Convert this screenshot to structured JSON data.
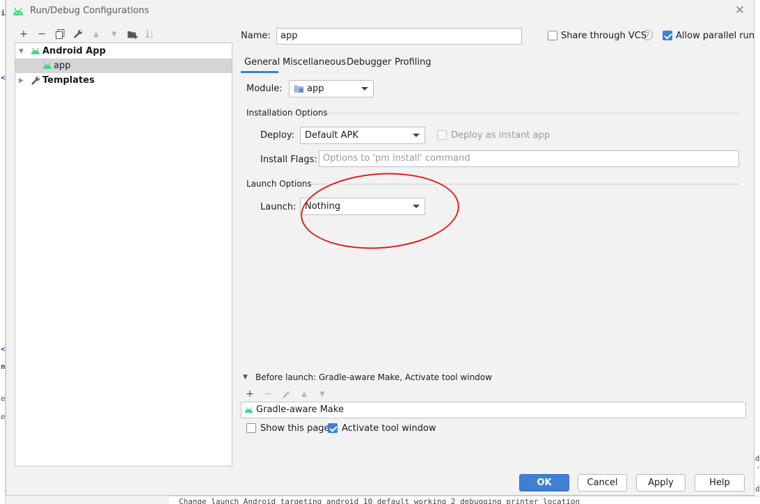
{
  "window": {
    "title": "Run/Debug Configurations"
  },
  "toolbar": {
    "add": "+",
    "remove": "−",
    "move_up": "▲",
    "move_down": "▼"
  },
  "tree": {
    "android_app": "Android App",
    "app": "app",
    "templates": "Templates"
  },
  "header": {
    "name_label": "Name:",
    "name_value": "app",
    "share_vcs": "Share through VCS",
    "help": "?",
    "allow_parallel": "Allow parallel run"
  },
  "tabs": [
    {
      "label": "General"
    },
    {
      "label": "Miscellaneous"
    },
    {
      "label": "Debugger"
    },
    {
      "label": "Profiling"
    }
  ],
  "general": {
    "module_label": "Module:",
    "module_value": "app",
    "installation_title": "Installation Options",
    "deploy_label": "Deploy:",
    "deploy_value": "Default APK",
    "instant_app": "Deploy as instant app",
    "install_flags_label": "Install Flags:",
    "install_flags_placeholder": "Options to 'pm install' command",
    "launch_title": "Launch Options",
    "launch_label": "Launch:",
    "launch_value": "Nothing"
  },
  "before_launch": {
    "title": "Before launch: Gradle-aware Make, Activate tool window",
    "task": "Gradle-aware Make",
    "show_page": "Show this page",
    "activate_window": "Activate tool window",
    "add": "+",
    "remove": "−",
    "up": "▲",
    "down": "▼"
  },
  "buttons": {
    "ok": "OK",
    "cancel": "Cancel",
    "apply": "Apply",
    "help": "Help"
  },
  "colors": {
    "accent": "#3d7fd8",
    "android_green": "#3ddc84",
    "annotation_red": "#e21b1b"
  },
  "background": {
    "glyph_i": "i",
    "glyph_lt1": "<",
    "glyph_lt2": "<",
    "glyph_n": "n",
    "glyph_e1": "e",
    "glyph_e2": "e",
    "glyph_d1": "d",
    "glyph_q": "'",
    "glyph_d2": "d",
    "code_line": "Change launch Android targeting android 10 default working 2 debugging printer location"
  }
}
